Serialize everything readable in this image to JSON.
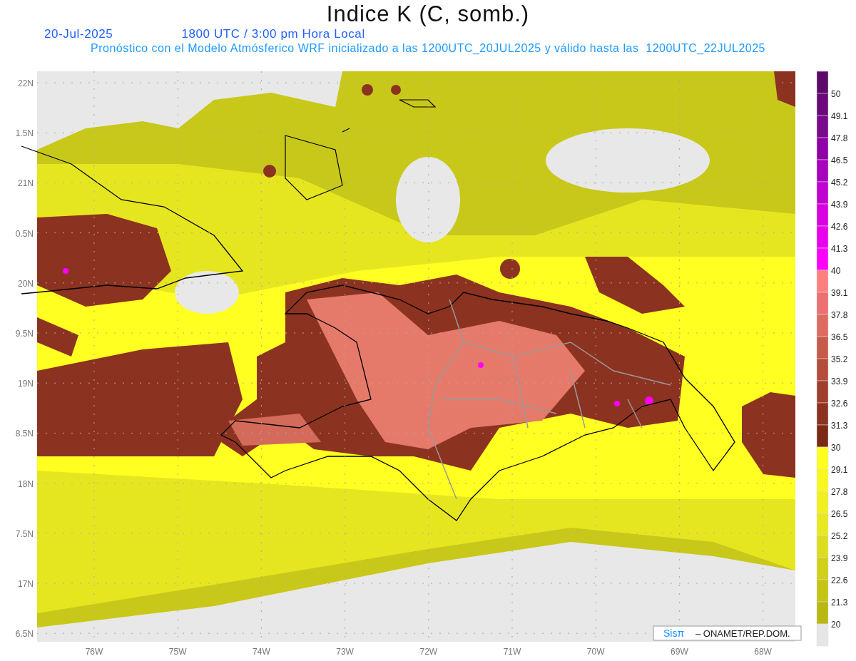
{
  "title": "Indice K (C, somb.)",
  "date": "20-Jul-2025",
  "time": "1800 UTC / 3:00 pm Hora Local",
  "subtitle": "Pronóstico con el Modelo Atmósferico WRF inicializado a las 1200UTC_20JUL2025 y válido hasta las  1200UTC_22JUL2025",
  "y_axis": [
    "22N",
    "1.5N",
    "21N",
    "0.5N",
    "20N",
    "9.5N",
    "19N",
    "8.5N",
    "18N",
    "7.5N",
    "17N",
    "6.5N"
  ],
  "x_axis": [
    "76W",
    "75W",
    "74W",
    "73W",
    "72W",
    "71W",
    "70W",
    "69W",
    "68W"
  ],
  "colorbar": [
    {
      "label": "50",
      "color": "#5c0a68"
    },
    {
      "label": "49.1",
      "color": "#6a0a78"
    },
    {
      "label": "47.8",
      "color": "#7a0a8c"
    },
    {
      "label": "46.5",
      "color": "#9000a8"
    },
    {
      "label": "45.2",
      "color": "#a800bc"
    },
    {
      "label": "43.9",
      "color": "#c000d0"
    },
    {
      "label": "42.6",
      "color": "#d800e0"
    },
    {
      "label": "41.3",
      "color": "#ea00ec"
    },
    {
      "label": "40",
      "color": "#ff00ff"
    },
    {
      "label": "39.1",
      "color": "#ff7f7f"
    },
    {
      "label": "37.8",
      "color": "#ec7070"
    },
    {
      "label": "36.5",
      "color": "#dc6a5f"
    },
    {
      "label": "35.2",
      "color": "#c85a4a"
    },
    {
      "label": "33.9",
      "color": "#b44c3c"
    },
    {
      "label": "32.6",
      "color": "#a03e2e"
    },
    {
      "label": "31.3",
      "color": "#8c3220"
    },
    {
      "label": "30",
      "color": "#7a2a14"
    },
    {
      "label": "29.1",
      "color": "#ffff20"
    },
    {
      "label": "27.8",
      "color": "#f8f820"
    },
    {
      "label": "26.5",
      "color": "#f0f020"
    },
    {
      "label": "25.2",
      "color": "#e8e820"
    },
    {
      "label": "23.9",
      "color": "#dcdc20"
    },
    {
      "label": "22.6",
      "color": "#d0d018"
    },
    {
      "label": "21.3",
      "color": "#c4c414"
    },
    {
      "label": "20",
      "color": "#b8b810"
    },
    {
      "color": "#e6e6e6"
    }
  ],
  "credit": {
    "logo": "Sisπ",
    "text": "– ONAMET/REP.DOM."
  }
}
